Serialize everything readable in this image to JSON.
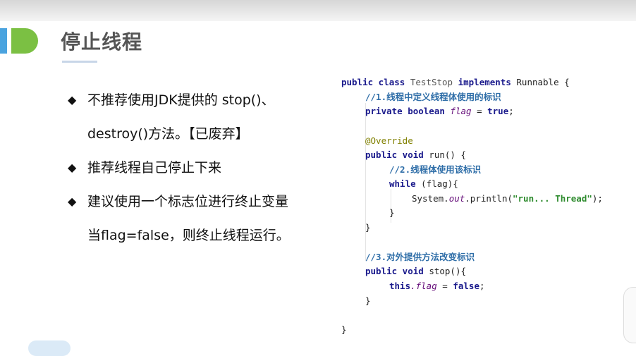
{
  "title": "停止线程",
  "bullets": [
    {
      "symbol": "◆",
      "text": "不推荐使用JDK提供的 stop()、"
    },
    {
      "symbol": "",
      "text": "destroy()方法。【已废弃】"
    },
    {
      "symbol": "◆",
      "text": "推荐线程自己停止下来"
    },
    {
      "symbol": "◆",
      "text": "建议使用一个标志位进行终止变量"
    },
    {
      "symbol": "",
      "text": "当flag=false，则终止线程运行。"
    }
  ],
  "code": {
    "l1_kw": "public class",
    "l1_cls": "TestStop",
    "l1_kw2": "implements",
    "l1_rest": "Runnable {",
    "l2": "//1.线程中定义线程体使用的标识",
    "l3_kw": "private boolean",
    "l3_var": "flag",
    "l3_eq": "=",
    "l3_val": "true",
    "l3_end": ";",
    "l4": "@Override",
    "l5_kw": "public void",
    "l5_rest": "run() {",
    "l6": "//2.线程体使用该标识",
    "l7_kw": "while",
    "l7_rest": "(flag){",
    "l8_pre": "System.",
    "l8_out": "out",
    "l8_mid": ".println(",
    "l8_str": "\"run... Thread\"",
    "l8_end": ");",
    "l9": "}",
    "l10": "}",
    "l11": "//3.对外提供方法改变标识",
    "l12_kw": "public void",
    "l12_rest": "stop(){",
    "l13_kw": "this",
    "l13_var": ".flag",
    "l13_eq": "=",
    "l13_val": "false",
    "l13_end": ";",
    "l14": "}",
    "l15": "}"
  }
}
